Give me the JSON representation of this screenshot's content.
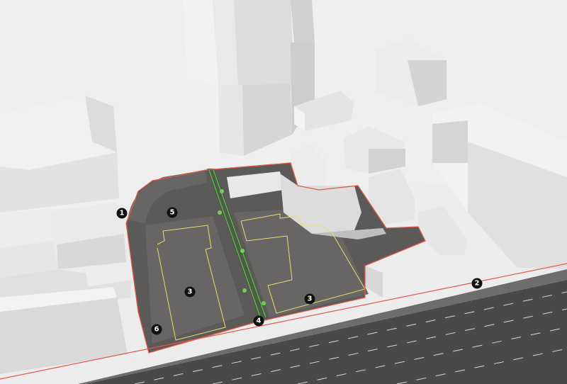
{
  "colors": {
    "ground": "#efefef",
    "building_light": "#f4f4f4",
    "building_mid": "#dedede",
    "building_dark": "#c7c7c7",
    "site_dark": "#5c5a59",
    "site_mid": "#6a6968",
    "road": "#4a4948",
    "boundary": "#e05a4a",
    "plot_outline": "#e8de6a",
    "path": "#5fbf4a",
    "marker": "#111111"
  },
  "markers": [
    {
      "id": "1",
      "label": "1"
    },
    {
      "id": "2",
      "label": "2"
    },
    {
      "id": "3a",
      "label": "3"
    },
    {
      "id": "3b",
      "label": "3"
    },
    {
      "id": "4",
      "label": "4"
    },
    {
      "id": "5",
      "label": "5"
    },
    {
      "id": "6",
      "label": "6"
    }
  ]
}
